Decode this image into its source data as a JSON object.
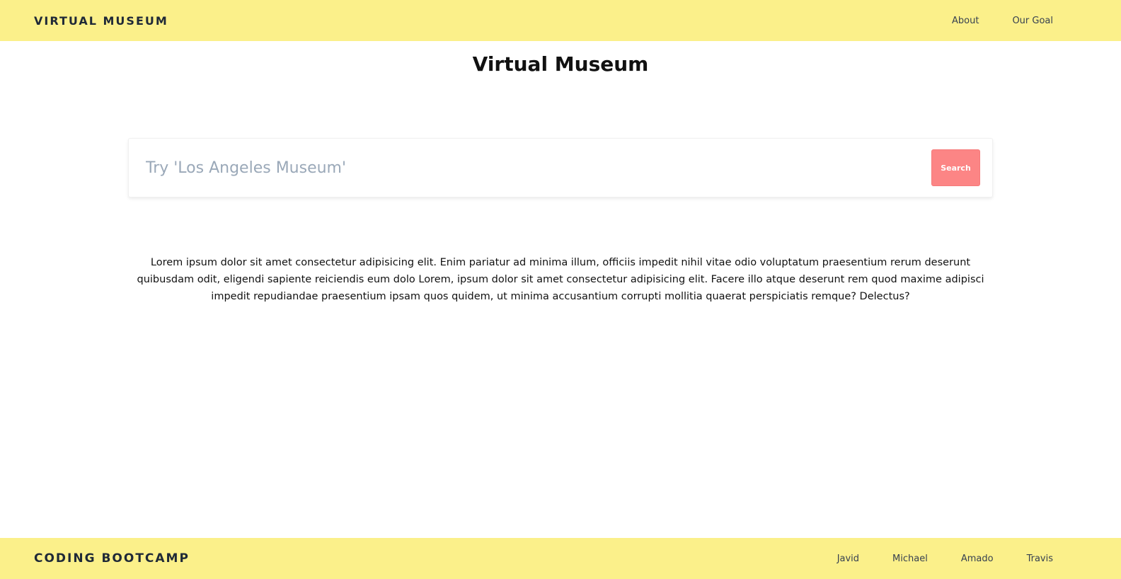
{
  "header": {
    "brand": "VIRTUAL MUSEUM",
    "nav": [
      {
        "label": "About"
      },
      {
        "label": "Our Goal"
      }
    ]
  },
  "main": {
    "title": "Virtual Museum",
    "search": {
      "placeholder": "Try 'Los Angeles Museum'",
      "value": "",
      "button_label": "Search"
    },
    "intro": "Lorem ipsum dolor sit amet consectetur adipisicing elit. Enim pariatur ad minima illum, officiis impedit nihil vitae odio voluptatum praesentium rerum deserunt quibusdam odit, eligendi sapiente reiciendis eum dolo Lorem, ipsum dolor sit amet consectetur adipisicing elit. Facere illo atque deserunt rem quod maxime adipisci impedit repudiandae praesentium ipsam quos quidem, ut minima accusantium corrupti mollitia quaerat perspiciatis remque? Delectus?"
  },
  "footer": {
    "brand": "CODING BOOTCAMP",
    "links": [
      {
        "label": "Javid"
      },
      {
        "label": "Michael"
      },
      {
        "label": "Amado"
      },
      {
        "label": "Travis"
      }
    ]
  },
  "colors": {
    "bar_background": "#fbf08a",
    "search_button": "#fc8585",
    "placeholder": "#9aa8b8"
  }
}
